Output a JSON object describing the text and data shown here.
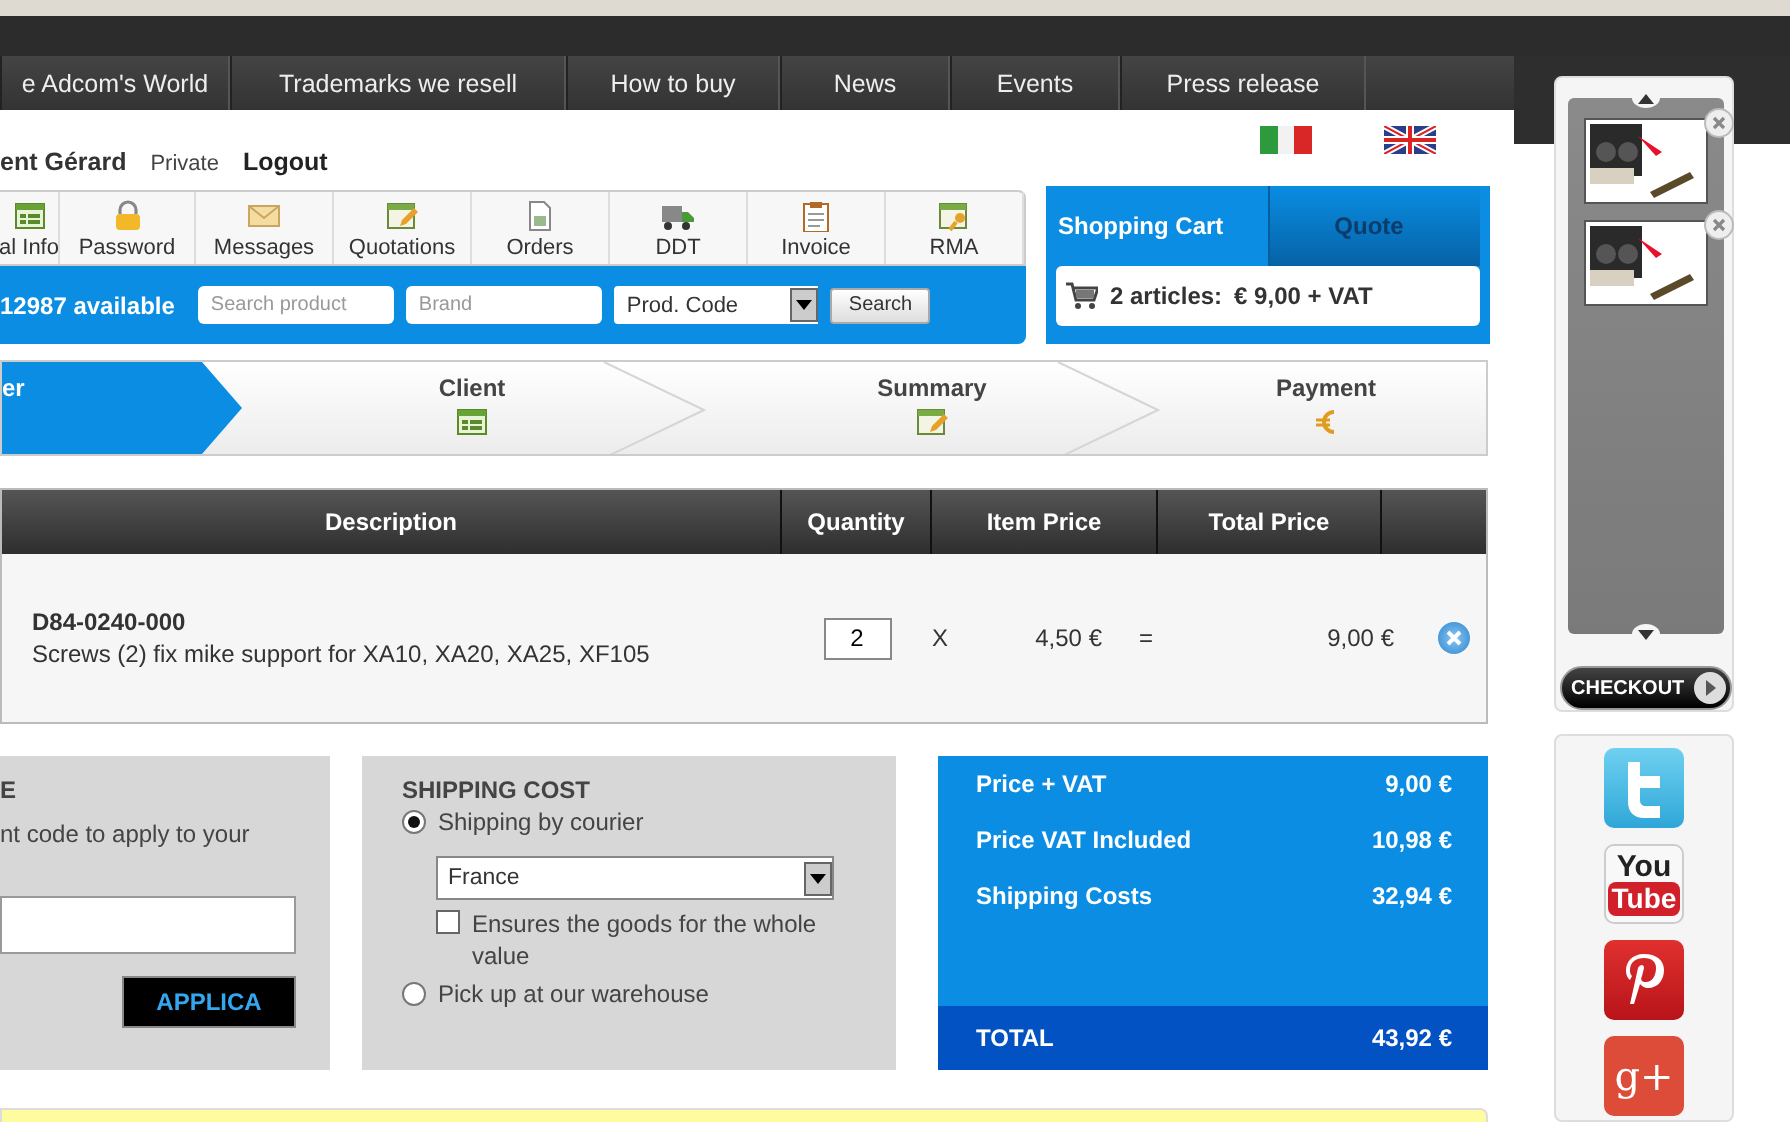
{
  "top_nav": [
    {
      "label": "e Adcom's World"
    },
    {
      "label": "Trademarks we resell"
    },
    {
      "label": "How to buy"
    },
    {
      "label": "News"
    },
    {
      "label": "Events"
    },
    {
      "label": "Press release"
    }
  ],
  "user": {
    "name": "ent Gérard",
    "type": "Private",
    "logout": "Logout"
  },
  "toolbar": [
    {
      "label": "al Info",
      "kind": "form"
    },
    {
      "label": "Password",
      "kind": "lock"
    },
    {
      "label": "Messages",
      "kind": "mail"
    },
    {
      "label": "Quotations",
      "kind": "edit"
    },
    {
      "label": "Orders",
      "kind": "sheet"
    },
    {
      "label": "DDT",
      "kind": "truck"
    },
    {
      "label": "Invoice",
      "kind": "clipboard"
    },
    {
      "label": "RMA",
      "kind": "key"
    }
  ],
  "search": {
    "available": "12987 available",
    "product_placeholder": "Search product",
    "brand_placeholder": "Brand",
    "field": "Prod. Code",
    "button": "Search"
  },
  "cart": {
    "tabs": [
      {
        "label": "Shopping Cart",
        "selected": true
      },
      {
        "label": "Quote",
        "selected": false
      }
    ],
    "articles": "2 articles:",
    "amount": "€ 9,00 + VAT"
  },
  "steps": [
    {
      "label": "er",
      "selected": true
    },
    {
      "label": "Client",
      "selected": false,
      "kind": "form"
    },
    {
      "label": "Summary",
      "selected": false,
      "kind": "edit"
    },
    {
      "label": "Payment",
      "selected": false,
      "kind": "euro"
    }
  ],
  "table": {
    "columns": [
      {
        "label": "Description"
      },
      {
        "label": "Quantity"
      },
      {
        "label": "Item Price"
      },
      {
        "label": "Total Price"
      }
    ],
    "rows": [
      {
        "code": "D84-0240-000",
        "description": "Screws (2) fix mike support for XA10, XA20, XA25, XF105",
        "quantity": "2",
        "times": "X",
        "item_price": "4,50 €",
        "equals": "=",
        "total_price": "9,00 €"
      }
    ]
  },
  "coupon": {
    "title": "E",
    "text": "nt code to apply to your",
    "button": "APPLICA"
  },
  "shipping": {
    "title": "SHIPPING COST",
    "options": [
      {
        "label": "Shipping by courier",
        "selected": true
      },
      {
        "label": "Pick up at our warehouse",
        "selected": false
      }
    ],
    "country": "France",
    "insurance": {
      "label": "Ensures the goods for the whole value",
      "checked": false
    }
  },
  "totals": {
    "lines": [
      {
        "label": "Price + VAT",
        "value": "9,00 €"
      },
      {
        "label": "Price VAT Included",
        "value": "10,98 €"
      },
      {
        "label": "Shipping Costs",
        "value": "32,94 €"
      }
    ],
    "total": {
      "label": "TOTAL",
      "value": "43,92 €"
    }
  },
  "mini_cart": {
    "checkout": "CHECKOUT"
  },
  "social": [
    {
      "kind": "twitter"
    },
    {
      "kind": "youtube",
      "label": "You",
      "label2": "Tube"
    },
    {
      "kind": "pinterest"
    },
    {
      "kind": "googleplus",
      "label": "g+"
    }
  ]
}
